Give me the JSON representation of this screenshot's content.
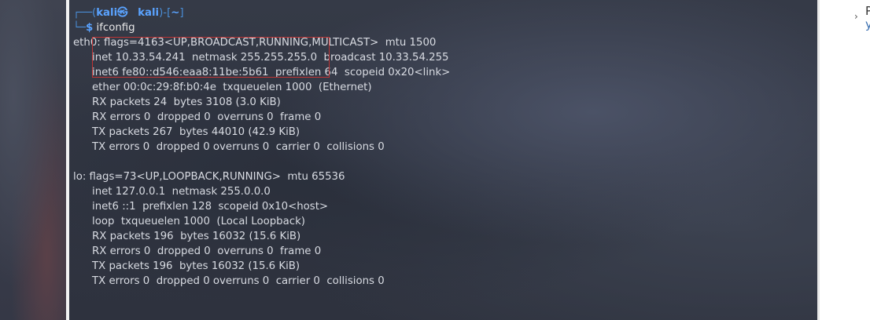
{
  "terminal": {
    "prompt": {
      "open": "┌──(",
      "user": "kali㉿",
      "gap": "   ",
      "host": "kali",
      "close": ")-[",
      "cwd": "~",
      "end": "]",
      "second_prefix": "└─",
      "dollar": "$",
      "command": "ifconfig"
    },
    "lines": [
      "eth0: flags=4163<UP,BROADCAST,RUNNING,MULTICAST>  mtu 1500",
      "inet 10.33.54.241  netmask 255.255.255.0  broadcast 10.33.54.255",
      "inet6 fe80::d546:eaa8:11be:5b61  prefixlen 64  scopeid 0x20<link>",
      "ether 00:0c:29:8f:b0:4e  txqueuelen 1000  (Ethernet)",
      "RX packets 24  bytes 3108 (3.0 KiB)",
      "RX errors 0  dropped 0  overruns 0  frame 0",
      "TX packets 267  bytes 44010 (42.9 KiB)",
      "TX errors 0  dropped 0 overruns 0  carrier 0  collisions 0",
      "",
      "lo: flags=73<UP,LOOPBACK,RUNNING>  mtu 65536",
      "inet 127.0.0.1  netmask 255.0.0.0",
      "inet6 ::1  prefixlen 128  scopeid 0x10<host>",
      "loop  txqueuelen 1000  (Local Loopback)",
      "RX packets 196  bytes 16032 (15.6 KiB)",
      "RX errors 0  dropped 0  overruns 0  frame 0",
      "TX packets 196  bytes 16032 (15.6 KiB)",
      "TX errors 0  dropped 0 overruns 0  carrier 0  collisions 0"
    ]
  },
  "right_panel": {
    "chevron": "›",
    "text_line1": "P",
    "text_line2": "y"
  },
  "colors": {
    "prompt_accent": "#5aa3ff",
    "highlight_border": "#c03434"
  }
}
